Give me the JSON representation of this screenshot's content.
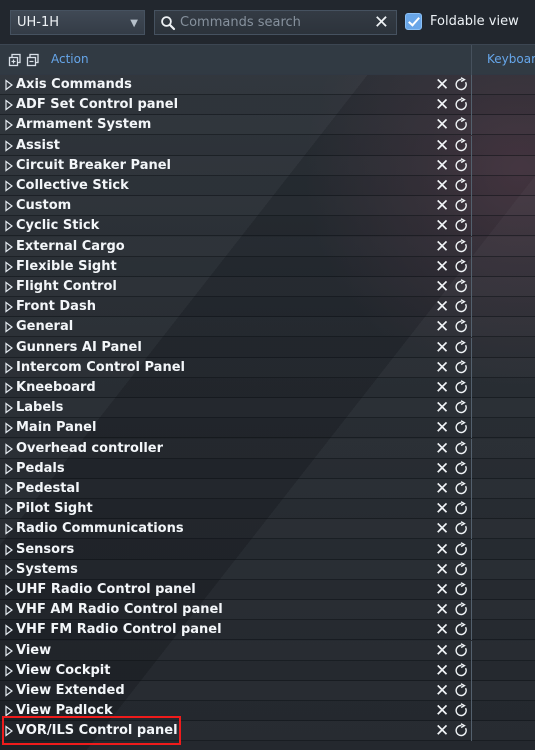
{
  "toolbar": {
    "module_value": "UH-1H",
    "search_placeholder": "Commands search",
    "search_value": "",
    "foldable_label": "Foldable view",
    "foldable_checked": true
  },
  "header": {
    "action_label": "Action",
    "keyboard_label": "Keyboard"
  },
  "categories": [
    "Axis Commands",
    "ADF Set Control panel",
    "Armament System",
    "Assist",
    "Circuit Breaker Panel",
    "Collective Stick",
    "Custom",
    "Cyclic Stick",
    "External Cargo",
    "Flexible Sight",
    "Flight Control",
    "Front Dash",
    "General",
    "Gunners AI Panel",
    "Intercom Control Panel",
    "Kneeboard",
    "Labels",
    "Main Panel",
    "Overhead controller",
    "Pedals",
    "Pedestal",
    "Pilot Sight",
    "Radio Communications",
    "Sensors",
    "Systems",
    "UHF Radio Control panel",
    "VHF AM Radio Control panel",
    "VHF FM Radio Control panel",
    "View",
    "View Cockpit",
    "View Extended",
    "View Padlock",
    "VOR/ILS Control panel"
  ],
  "icons": {
    "search": "search-icon",
    "clear": "close-icon",
    "reset": "reset-icon",
    "expand": "expand-icon",
    "expand_all": "expand-all-icon",
    "collapse_all": "collapse-all-icon"
  },
  "colors": {
    "accent": "#66a6ea",
    "highlight": "#ef1b1b",
    "checkbox": "#69a6e8"
  },
  "highlighted_item": "VOR/ILS Control panel"
}
